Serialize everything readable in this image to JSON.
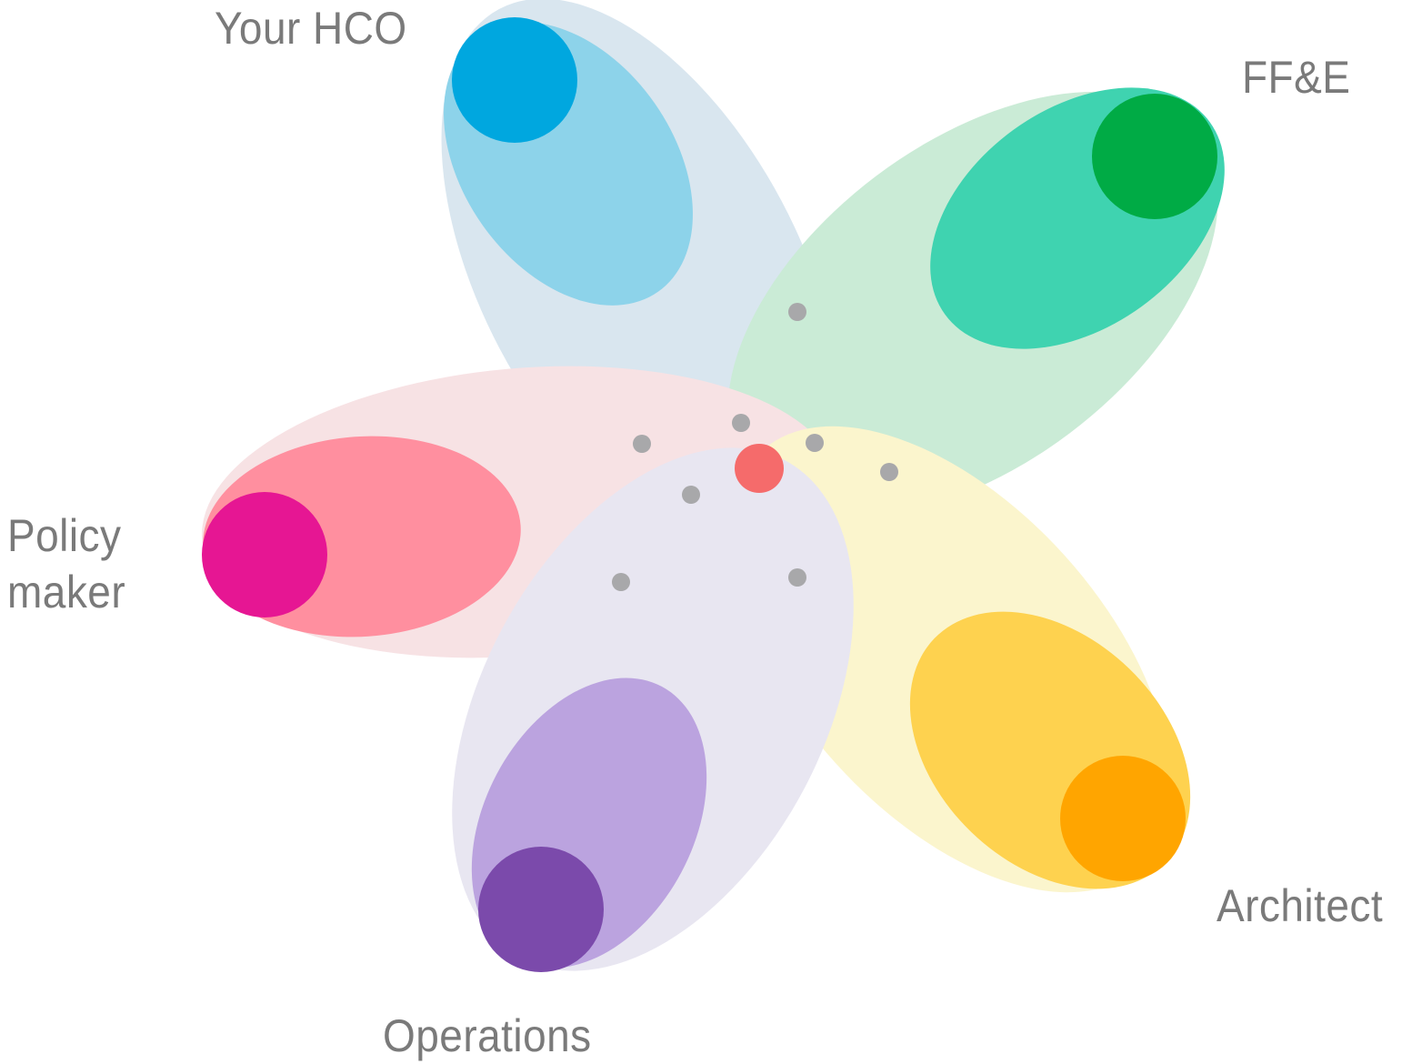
{
  "labels": {
    "hco": "Your HCO",
    "ffe": "FF&E",
    "policy": "Policy\nmaker",
    "architect": "Architect",
    "operations": "Operations"
  },
  "colors": {
    "hco": {
      "outer": "#c9dce9",
      "inner": "#8dd3ea",
      "dot": "#00a7df"
    },
    "ffe": {
      "outer": "#b5e3c5",
      "inner": "#3fd3b0",
      "dot": "#00ab45"
    },
    "policy": {
      "outer": "#f5d6da",
      "inner": "#ff8f9f",
      "dot": "#e61693"
    },
    "architect": {
      "outer": "#faf1b9",
      "inner": "#fed24f",
      "dot": "#ffa500"
    },
    "operations": {
      "outer": "#dfdcec",
      "inner": "#bba3df",
      "dot": "#7b4aab"
    },
    "center": "#f56b6b",
    "connector": "#a8a8aa",
    "label_text": "#7a7a7a"
  }
}
